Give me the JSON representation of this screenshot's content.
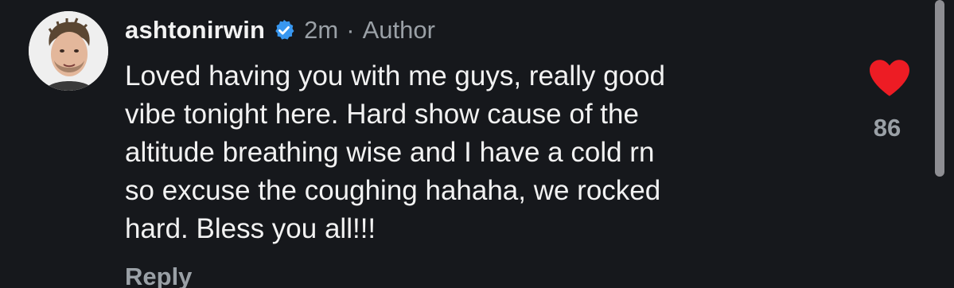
{
  "comment": {
    "username": "ashtonirwin",
    "timestamp": "2m",
    "separator": "·",
    "role_label": "Author",
    "text_lines": [
      "Loved having you with me guys, really good",
      "vibe tonight here. Hard show cause of the",
      "altitude breathing wise and I have a cold rn",
      "so excuse the coughing hahaha, we rocked",
      "hard. Bless you all!!!"
    ],
    "reply_label": "Reply",
    "like_count": "86",
    "liked": true
  },
  "icons": {
    "verified": "verified-badge-icon",
    "like": "heart-icon"
  },
  "colors": {
    "background": "#16181c",
    "text_primary": "#f2f2f2",
    "text_secondary": "#9aa0a6",
    "verified_blue": "#3897f0",
    "heart_red": "#ed1c24"
  }
}
